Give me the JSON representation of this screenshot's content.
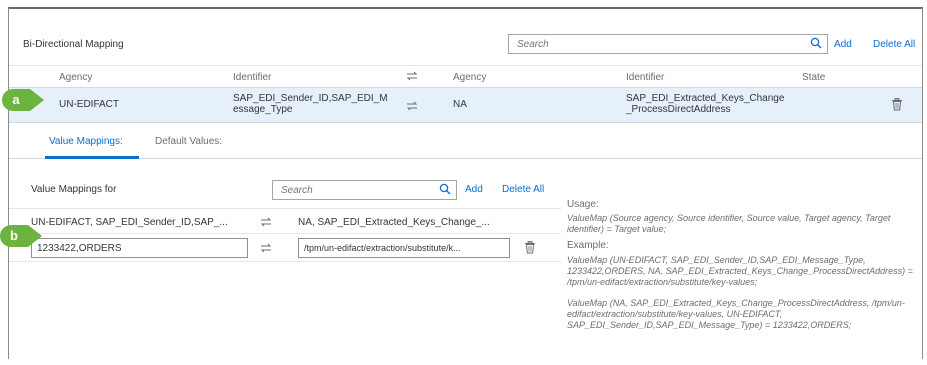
{
  "header": {
    "title": "Bi-Directional Mapping",
    "search_placeholder": "Search",
    "add_label": "Add",
    "delete_all_label": "Delete All"
  },
  "columns": {
    "agency": "Agency",
    "identifier": "Identifier",
    "target_agency": "Agency",
    "target_identifier": "Identifier",
    "state": "State"
  },
  "selected_row": {
    "source_agency": "UN-EDIFACT",
    "source_identifier": "SAP_EDI_Sender_ID,SAP_EDI_Message_Type",
    "target_agency": "NA",
    "target_identifier": "SAP_EDI_Extracted_Keys_Change_ProcessDirectAddress"
  },
  "tabs": [
    {
      "label": "Value Mappings:"
    },
    {
      "label": "Default Values:"
    }
  ],
  "value_mappings": {
    "label": "Value Mappings for",
    "search_placeholder": "Search",
    "add_label": "Add",
    "delete_all_label": "Delete All",
    "source_header": "UN-EDIFACT, SAP_EDI_Sender_ID,SAP_...",
    "target_header": "NA, SAP_EDI_Extracted_Keys_Change_...",
    "source_value": "1233422,ORDERS",
    "target_value": "/tpm/un-edifact/extraction/substitute/k..."
  },
  "usage": {
    "usage_label": "Usage:",
    "usage_text": "ValueMap (Source agency, Source identifier, Source value, Target agency, Target identifier) = Target value;",
    "example_label": "Example:",
    "example1": "ValueMap (UN-EDIFACT, SAP_EDI_Sender_ID,SAP_EDI_Message_Type, 1233422,ORDERS, NA, SAP_EDI_Extracted_Keys_Change_ProcessDirectAddress) = /tpm/un-edifact/extraction/substitute/key-values;",
    "example2": "ValueMap (NA, SAP_EDI_Extracted_Keys_Change_ProcessDirectAddress, /tpm/un-edifact/extraction/substitute/key-values, UN-EDIFACT, SAP_EDI_Sender_ID,SAP_EDI_Message_Type) = 1233422,ORDERS;"
  },
  "callouts": {
    "a": "a",
    "b": "b"
  },
  "icons": {
    "search": "search-icon",
    "swap": "swap-arrows-icon",
    "delete": "trash-icon"
  },
  "colors": {
    "accent": "#0a6ed1",
    "selected_row": "#e5f0fa",
    "callout": "#6db33f"
  }
}
